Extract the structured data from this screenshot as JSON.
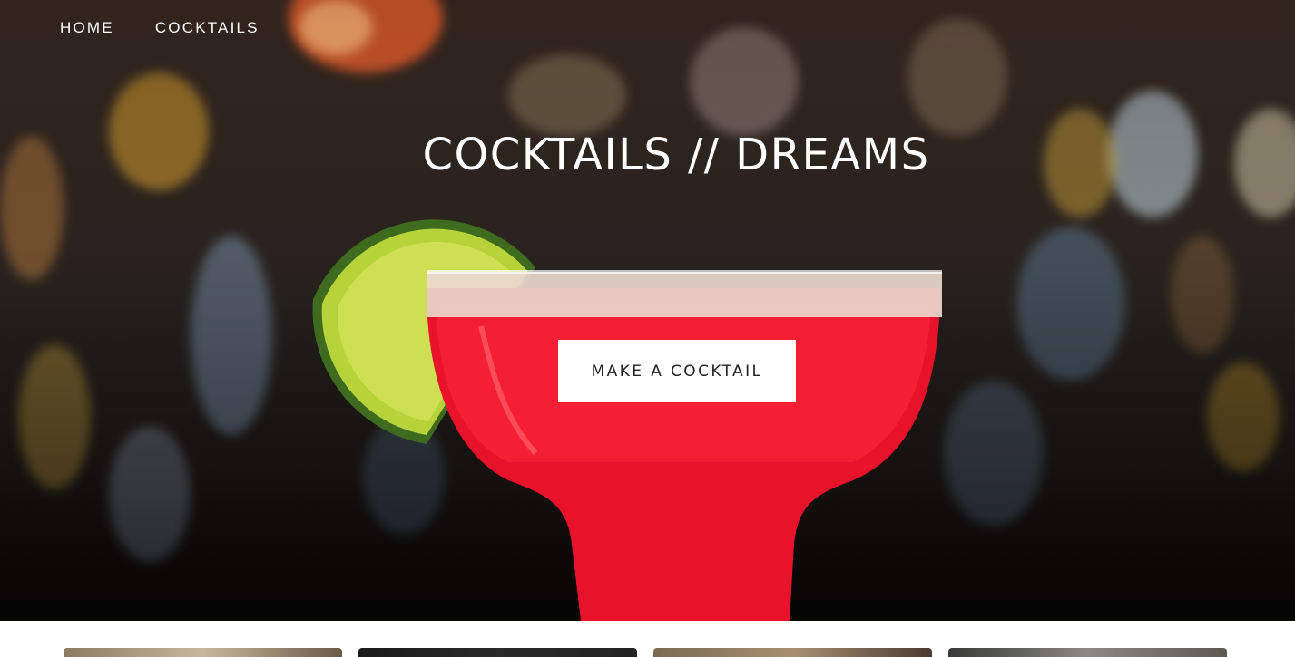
{
  "nav": {
    "items": [
      {
        "label": "HOME"
      },
      {
        "label": "COCKTAILS"
      }
    ]
  },
  "hero": {
    "title": "COCKTAILS // DREAMS",
    "cta_label": "MAKE A COCKTAIL"
  },
  "colors": {
    "drink": "#e8132a",
    "lime": "#b8d23a",
    "cta_bg": "#ffffff",
    "text_light": "#ffffff"
  },
  "cards": [
    {
      "label": ""
    },
    {
      "label": ""
    },
    {
      "label": ""
    },
    {
      "label": ""
    }
  ]
}
